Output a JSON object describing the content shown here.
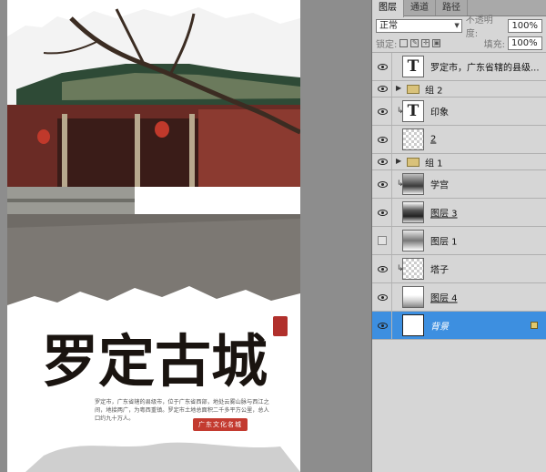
{
  "panel": {
    "tabs": [
      {
        "label": "图层",
        "active": true
      },
      {
        "label": "通道",
        "active": false
      },
      {
        "label": "路径",
        "active": false
      }
    ],
    "blend_mode": "正常",
    "opacity_label": "不透明度:",
    "opacity_value": "100%",
    "lock_label": "锁定:",
    "fill_label": "填充:",
    "fill_value": "100%"
  },
  "layers": [
    {
      "name": "罗定市，广东省辖的县级...",
      "kind": "text",
      "visible": true
    },
    {
      "name": "组 2",
      "kind": "group",
      "visible": true
    },
    {
      "name": "印象",
      "kind": "text",
      "visible": true,
      "clipped": true
    },
    {
      "name": "2",
      "kind": "pixel",
      "visible": true
    },
    {
      "name": "组 1",
      "kind": "group",
      "visible": true
    },
    {
      "name": "学宫",
      "kind": "pixel",
      "visible": true,
      "clipped": true
    },
    {
      "name": "图层 3",
      "kind": "pixel",
      "visible": true
    },
    {
      "name": "图层 1",
      "kind": "pixel",
      "visible": false
    },
    {
      "name": "塔子",
      "kind": "pixel",
      "visible": true,
      "clipped": true
    },
    {
      "name": "图层 4",
      "kind": "pixel",
      "visible": true
    },
    {
      "name": "背景",
      "kind": "background",
      "visible": true,
      "selected": true,
      "locked": true
    }
  ],
  "document": {
    "title_text": "罗定古城",
    "body_text": "罗定市，广东省辖的县级市，位于广东省西部，地处云雾山脉与西江之间，地接两广，为粤西重镇。罗定市土地总面积二千多平方公里，总人口约九十万人。",
    "stamp_text": "广东文化名城"
  },
  "colors": {
    "selection": "#3d8fe0",
    "panel_bg": "#d6d6d6",
    "workspace": "#8d8d8d",
    "seal_red": "#c33a2f"
  }
}
